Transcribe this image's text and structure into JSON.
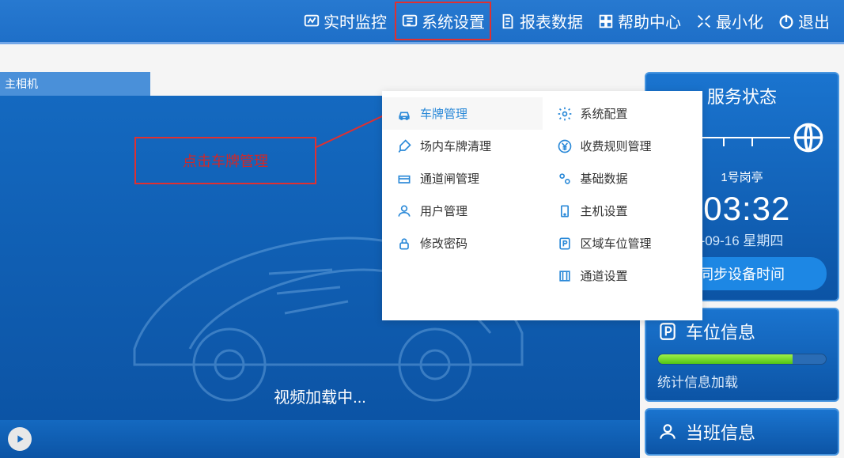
{
  "topnav": {
    "monitor": "实时监控",
    "settings": "系统设置",
    "reports": "报表数据",
    "help": "帮助中心",
    "minimize": "最小化",
    "exit": "退出"
  },
  "camera_tab": "主相机",
  "annotation": "点击车牌管理",
  "dropdown": {
    "left": [
      "车牌管理",
      "场内车牌清理",
      "通道闸管理",
      "用户管理",
      "修改密码"
    ],
    "right": [
      "系统配置",
      "收费规则管理",
      "基础数据",
      "主机设置",
      "区域车位管理",
      "通道设置"
    ]
  },
  "video_loading": "视频加载中...",
  "service": {
    "title": "服务状态",
    "booth": "1号岗亭",
    "time": ":03:32",
    "date": "-09-16 星期四",
    "sync_btn": "同步设备时间"
  },
  "parking": {
    "title": "车位信息",
    "stat": "统计信息加载"
  },
  "shift": {
    "title": "当班信息"
  }
}
